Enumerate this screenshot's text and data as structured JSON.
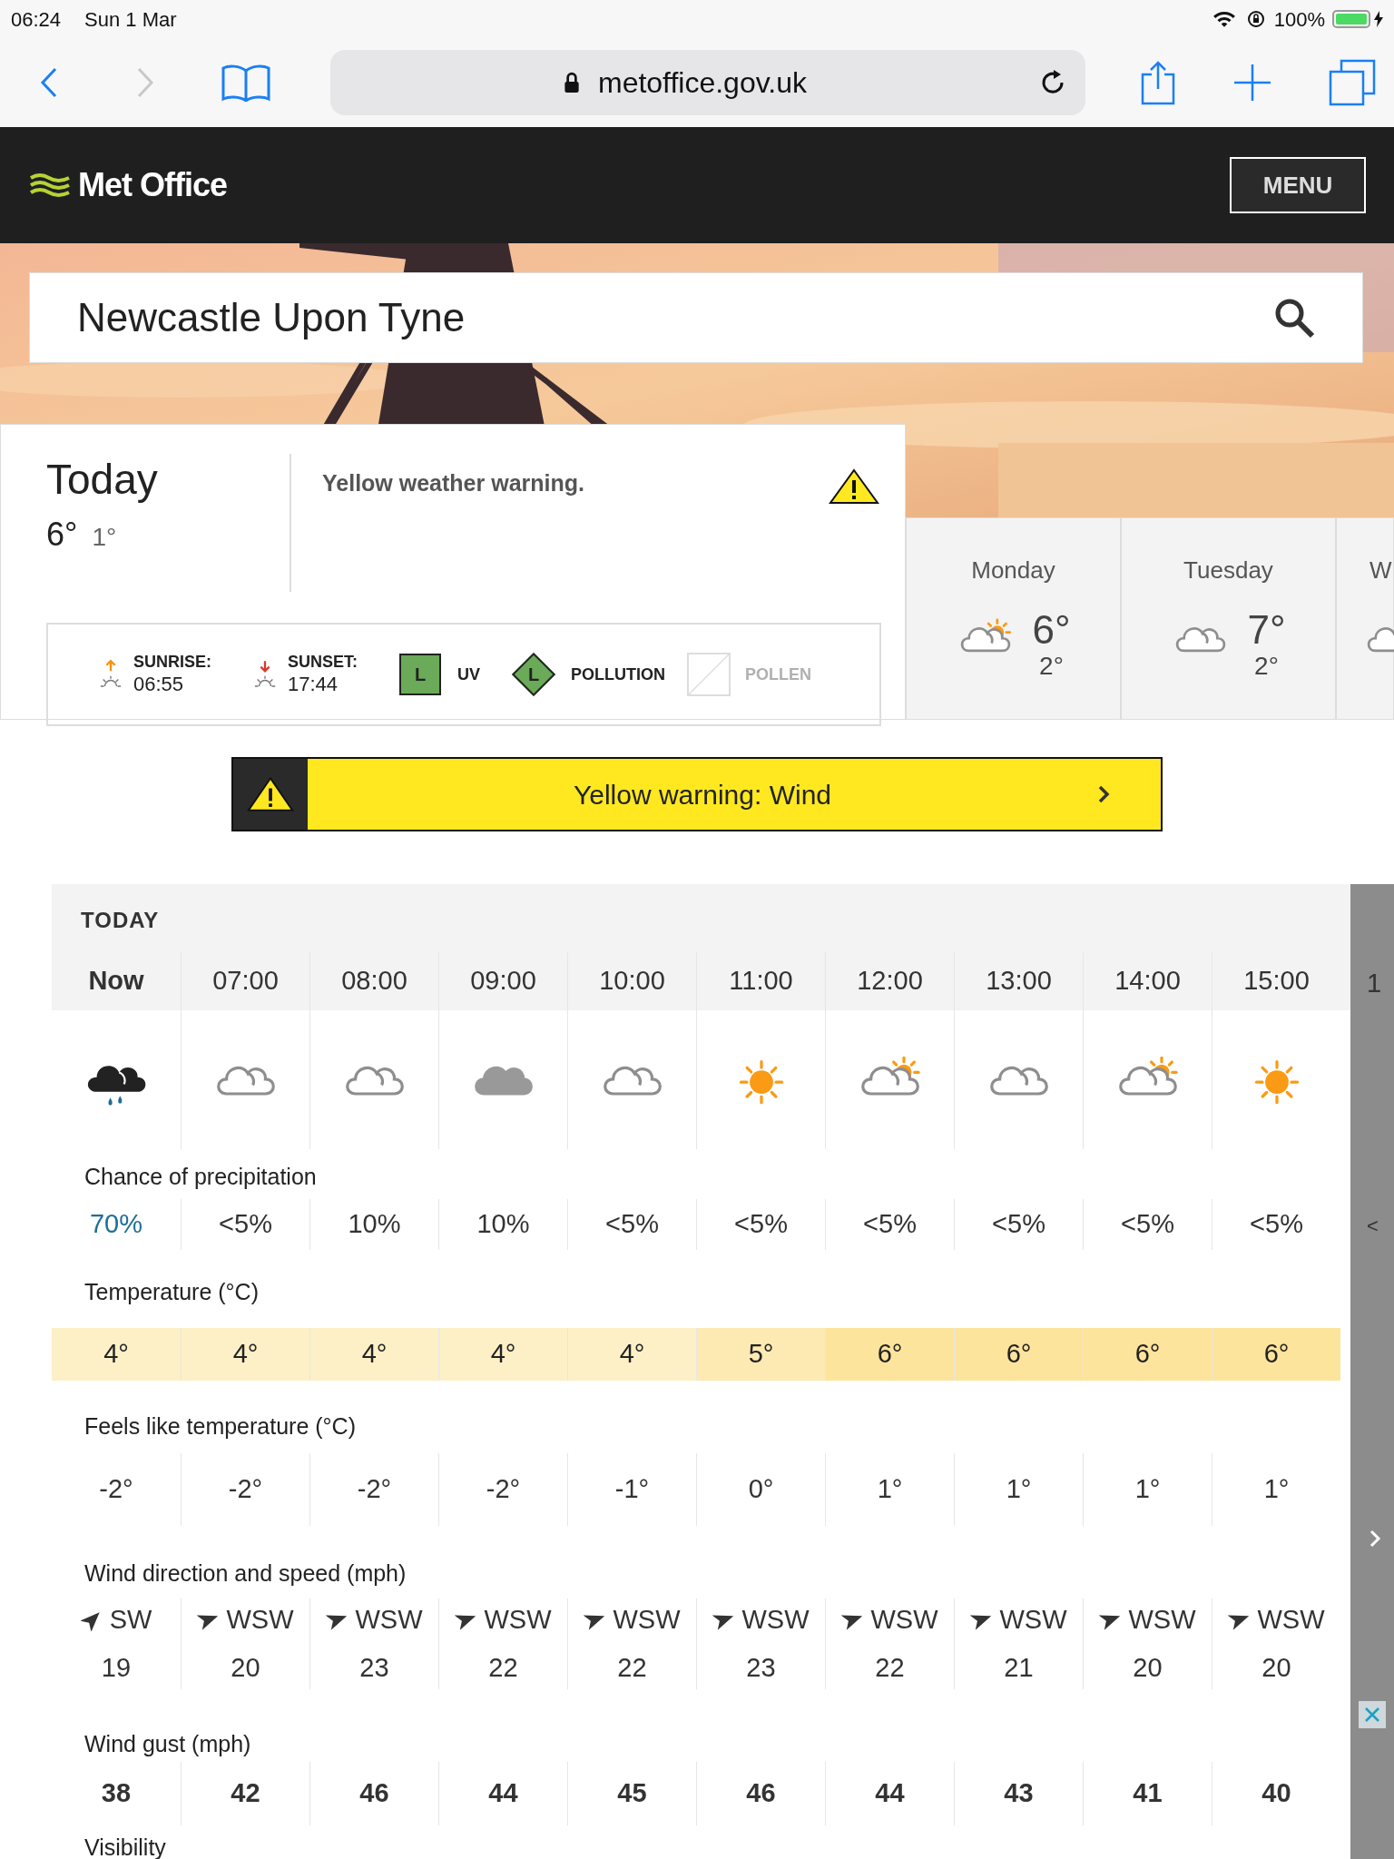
{
  "status_bar": {
    "time": "06:24",
    "date": "Sun 1 Mar",
    "battery": "100%",
    "charging": true
  },
  "browser": {
    "back_disabled": false,
    "forward_disabled": true,
    "url": "metoffice.gov.uk"
  },
  "header": {
    "logo": "Met Office",
    "menu": "MENU"
  },
  "search": {
    "value": "Newcastle Upon Tyne"
  },
  "today": {
    "title": "Today",
    "high": "6°",
    "low": "1°",
    "warning": "Yellow weather warning.",
    "sunrise_label": "SUNRISE:",
    "sunrise": "06:55",
    "sunset_label": "SUNSET:",
    "sunset": "17:44",
    "uv": {
      "value": "L",
      "label": "UV",
      "color": "#6aaa58"
    },
    "pollution": {
      "value": "L",
      "label": "POLLUTION",
      "color": "#6aaa58"
    },
    "pollen": {
      "label": "POLLEN",
      "disabled": true
    }
  },
  "days": [
    {
      "day": "Monday",
      "icon": {
        "kind": "sun_cloud"
      },
      "high": "6°",
      "low": "2°"
    },
    {
      "day": "Tuesday",
      "icon": {
        "kind": "cloud"
      },
      "high": "7°",
      "low": "2°"
    },
    {
      "day": "W",
      "icon": {
        "kind": "cloud"
      }
    }
  ],
  "warning_banner": {
    "text": "Yellow warning: Wind"
  },
  "forecast": {
    "heading": "TODAY",
    "precipitation_label": "Chance of precipitation",
    "temperature_label": "Temperature (°C)",
    "feels_like_label": "Feels like temperature (°C)",
    "wind_label": "Wind direction and speed (mph)",
    "gust_label": "Wind gust (mph)",
    "visibility_label": "Visibility",
    "hours": [
      {
        "time": "Now",
        "current": true,
        "icon": {
          "kind": "heavy_rain"
        },
        "precipitation": "70%",
        "emphasis": true,
        "temperature": "4°",
        "color": "#fdf0c6",
        "feels_like": "-2°",
        "wind_direction": "SW",
        "arrow": {
          "kind": "northeast"
        },
        "wind_speed": "19",
        "gust": "38"
      },
      {
        "time": "07:00",
        "current": false,
        "icon": {
          "kind": "cloud"
        },
        "precipitation": "<5%",
        "emphasis": false,
        "temperature": "4°",
        "color": "#fdf0c6",
        "feels_like": "-2°",
        "wind_direction": "WSW",
        "arrow": {
          "kind": "east_northeast"
        },
        "wind_speed": "20",
        "gust": "42"
      },
      {
        "time": "08:00",
        "current": false,
        "icon": {
          "kind": "cloud"
        },
        "precipitation": "10%",
        "emphasis": false,
        "temperature": "4°",
        "color": "#fdf0c6",
        "feels_like": "-2°",
        "wind_direction": "WSW",
        "arrow": {
          "kind": "east_northeast"
        },
        "wind_speed": "23",
        "gust": "46"
      },
      {
        "time": "09:00",
        "current": false,
        "icon": {
          "kind": "overcast"
        },
        "precipitation": "10%",
        "emphasis": false,
        "temperature": "4°",
        "color": "#fdf0c6",
        "feels_like": "-2°",
        "wind_direction": "WSW",
        "arrow": {
          "kind": "east_northeast"
        },
        "wind_speed": "22",
        "gust": "44"
      },
      {
        "time": "10:00",
        "current": false,
        "icon": {
          "kind": "cloud"
        },
        "precipitation": "<5%",
        "emphasis": false,
        "temperature": "4°",
        "color": "#fdf0c6",
        "feels_like": "-1°",
        "wind_direction": "WSW",
        "arrow": {
          "kind": "east_northeast"
        },
        "wind_speed": "22",
        "gust": "45"
      },
      {
        "time": "11:00",
        "current": false,
        "icon": {
          "kind": "sun"
        },
        "precipitation": "<5%",
        "emphasis": false,
        "temperature": "5°",
        "color": "#fdeab2",
        "feels_like": "0°",
        "wind_direction": "WSW",
        "arrow": {
          "kind": "east_northeast"
        },
        "wind_speed": "23",
        "gust": "46"
      },
      {
        "time": "12:00",
        "current": false,
        "icon": {
          "kind": "sun_cloud"
        },
        "precipitation": "<5%",
        "emphasis": false,
        "temperature": "6°",
        "color": "#fde49c",
        "feels_like": "1°",
        "wind_direction": "WSW",
        "arrow": {
          "kind": "east_northeast"
        },
        "wind_speed": "22",
        "gust": "44"
      },
      {
        "time": "13:00",
        "current": false,
        "icon": {
          "kind": "cloud"
        },
        "precipitation": "<5%",
        "emphasis": false,
        "temperature": "6°",
        "color": "#fde49c",
        "feels_like": "1°",
        "wind_direction": "WSW",
        "arrow": {
          "kind": "east_northeast"
        },
        "wind_speed": "21",
        "gust": "43"
      },
      {
        "time": "14:00",
        "current": false,
        "icon": {
          "kind": "sun_cloud"
        },
        "precipitation": "<5%",
        "emphasis": false,
        "temperature": "6°",
        "color": "#fde49c",
        "feels_like": "1°",
        "wind_direction": "WSW",
        "arrow": {
          "kind": "east_northeast"
        },
        "wind_speed": "20",
        "gust": "41"
      },
      {
        "time": "15:00",
        "current": false,
        "icon": {
          "kind": "sun"
        },
        "precipitation": "<5%",
        "emphasis": false,
        "temperature": "6°",
        "color": "#fde49c",
        "feels_like": "1°",
        "wind_direction": "WSW",
        "arrow": {
          "kind": "east_northeast"
        },
        "wind_speed": "20",
        "gust": "40"
      }
    ],
    "partial_column": {
      "time": "1",
      "precipitation": "<"
    }
  }
}
